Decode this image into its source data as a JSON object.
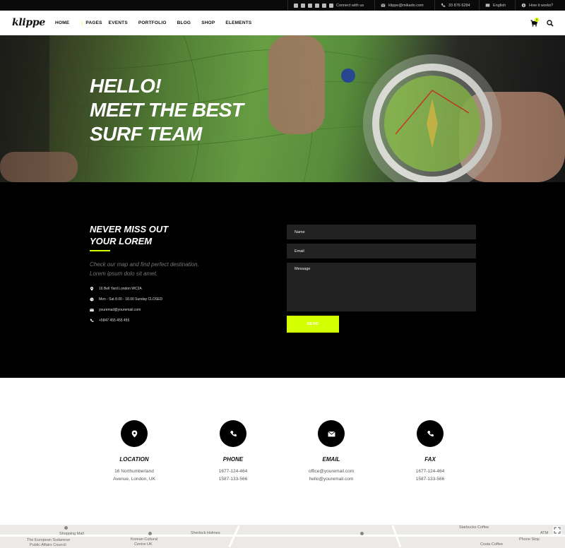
{
  "topbar": {
    "social_icons": [
      "vimeo-icon",
      "linkedin-icon",
      "facebook-icon",
      "tumblr-icon",
      "twitter-icon",
      "instagram-icon"
    ],
    "connect_label": "Connect with us",
    "email": "klippe@mikado.com",
    "phone": "33 876 6284",
    "language": "English",
    "how_it_works": "How it works?"
  },
  "nav": {
    "logo": "klippe",
    "items": [
      "HOME",
      "PAGES",
      "EVENTS",
      "PORTFOLIO",
      "BLOG",
      "SHOP",
      "ELEMENTS"
    ],
    "cart_count": "0"
  },
  "hero": {
    "lines": [
      "HELLO!",
      "MEET THE BEST",
      "SURF TEAM"
    ]
  },
  "contact_form_section": {
    "heading_lines": [
      "NEVER MISS OUT",
      "YOUR LOREM"
    ],
    "lead_lines": [
      "Check our map and find perfect destination.",
      "Lorem ipsum dolo sit amet."
    ],
    "info": [
      {
        "icon": "location-pin-icon",
        "text": "16 Bell Yard London WC2A"
      },
      {
        "icon": "clock-icon",
        "text": "Mon - Sat 8.00 - 18.00 Sunday CLOSED"
      },
      {
        "icon": "envelope-icon",
        "text": "youremail@youremail.com"
      },
      {
        "icon": "phone-icon",
        "text": "+5847 455 455 455"
      }
    ],
    "form": {
      "name_placeholder": "Name",
      "email_placeholder": "Email",
      "message_placeholder": "Message",
      "send_label": "SEND"
    }
  },
  "contacts": [
    {
      "icon": "location-pin-icon",
      "title": "LOCATION",
      "lines": [
        "16 Northumberland",
        "Avenue, London, UK"
      ]
    },
    {
      "icon": "phone-icon",
      "title": "PHONE",
      "lines": [
        "1677-124-464",
        "1587-133-566"
      ]
    },
    {
      "icon": "envelope-icon",
      "title": "EMAIL",
      "lines": [
        "office@youremail.com",
        "hello@youremail.com"
      ]
    },
    {
      "icon": "phone-icon",
      "title": "FAX",
      "lines": [
        "1677-124-464",
        "1587-133-566"
      ]
    }
  ],
  "map": {
    "labels": [
      "Shopping Mall",
      "The European Sudanese",
      "Public Affairs Council",
      "Korean Cultural",
      "Centre UK",
      "Sherlock Holmes",
      "Starbucks Coffee",
      "Phone Stop",
      "ATM",
      "Costa Coffee"
    ]
  },
  "colors": {
    "accent": "#d4ff00",
    "dark_bg": "#000000",
    "field_bg": "#222222"
  }
}
